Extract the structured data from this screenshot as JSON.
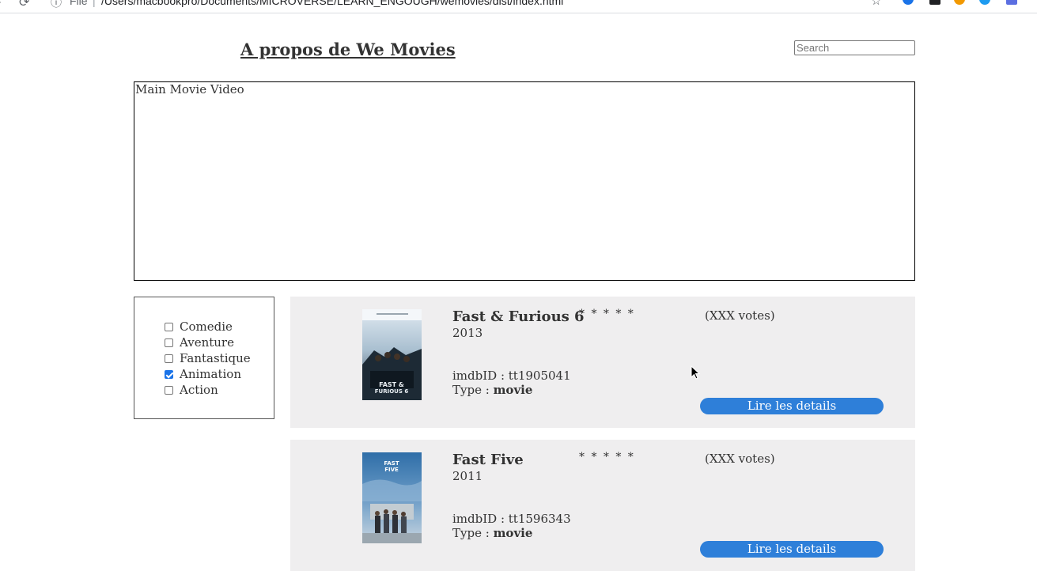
{
  "browser": {
    "file_label": "File",
    "url": "/Users/macbookpro/Documents/MICROVERSE/LEARN_ENGOUGH/wemovies/dist/index.html",
    "extension_badge": "3"
  },
  "header": {
    "about_link": "A propos de We Movies",
    "search_placeholder": "Search"
  },
  "video": {
    "label": "Main Movie Video"
  },
  "filters": [
    {
      "label": "Comedie",
      "checked": false
    },
    {
      "label": "Aventure",
      "checked": false
    },
    {
      "label": "Fantastique",
      "checked": false
    },
    {
      "label": "Animation",
      "checked": true
    },
    {
      "label": "Action",
      "checked": false
    }
  ],
  "movies": [
    {
      "title": "Fast & Furious 6",
      "year": "2013",
      "stars": "* * * * *",
      "votes": "(XXX votes)",
      "imdb": "imdbID : tt1905041",
      "type_label": "Type : ",
      "type_value": "movie",
      "button": "Lire les details"
    },
    {
      "title": "Fast Five",
      "year": "2011",
      "stars": "* * * * *",
      "votes": "(XXX votes)",
      "imdb": "imdbID : tt1596343",
      "type_label": "Type : ",
      "type_value": "movie",
      "button": "Lire les details"
    }
  ],
  "colors": {
    "card_bg": "#efeeef",
    "button_bg": "#2e7fd9",
    "text": "#333333"
  }
}
